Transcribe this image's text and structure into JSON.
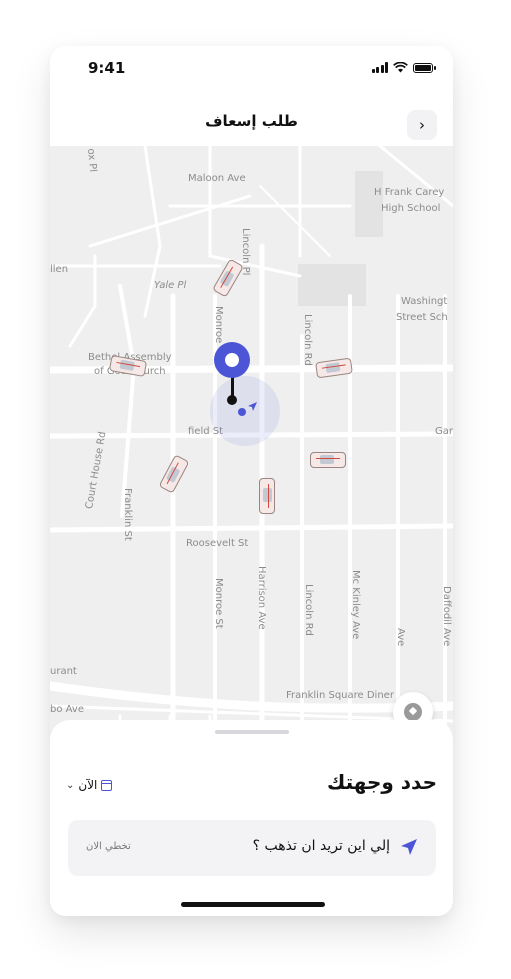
{
  "status_bar": {
    "time": "9:41"
  },
  "header": {
    "title": "طلب إسعاف",
    "back_label": "›"
  },
  "map": {
    "labels": {
      "maloon": "Maloon Ave",
      "hfrank": "H Frank Carey",
      "hschool": "High School",
      "allen": "llen",
      "yale": "Yale Pl",
      "lincoln_pl": "Lincoln Pl",
      "washington": "Washingt",
      "street_sch": "Street Sch",
      "bethel": "Bethel Assembly",
      "god_church": "of God Church",
      "monroe_top": "Monroe",
      "lincoln_rd_top": "Lincoln Rd",
      "court_house": "Court House Rd",
      "field_st": "field St",
      "gar": "Gar",
      "franklin_st": "Franklin St",
      "roosevelt": "Roosevelt St",
      "monroe_st": "Monroe St",
      "harrison": "Harrison Ave",
      "lincoln_rd": "Lincoln Rd",
      "mckinley": "Mc Kinley Ave",
      "ave_short": "Ave",
      "daffodil": "Daffodil Ave",
      "urant": "urant",
      "bo_ave": "bo Ave",
      "franklin_sq": "Franklin Square Diner",
      "ox_pl": "ox Pl"
    }
  },
  "icons": {
    "pickup_pin": "location-pin-icon",
    "user_location": "user-location-icon",
    "compass": "compass-icon",
    "recenter": "target-location-icon",
    "calendar": "calendar-icon",
    "navigation": "navigation-arrow-icon",
    "chevron": "chevron-down-icon"
  },
  "sheet": {
    "title": "حدد وجهتك",
    "time_label": "الآن",
    "destination_placeholder": "إلي اين تريد ان تذهب ؟",
    "skip_label": "تخطي الان"
  },
  "colors": {
    "accent": "#4b55d6",
    "map_bg": "#efefef",
    "road": "#ffffff"
  }
}
